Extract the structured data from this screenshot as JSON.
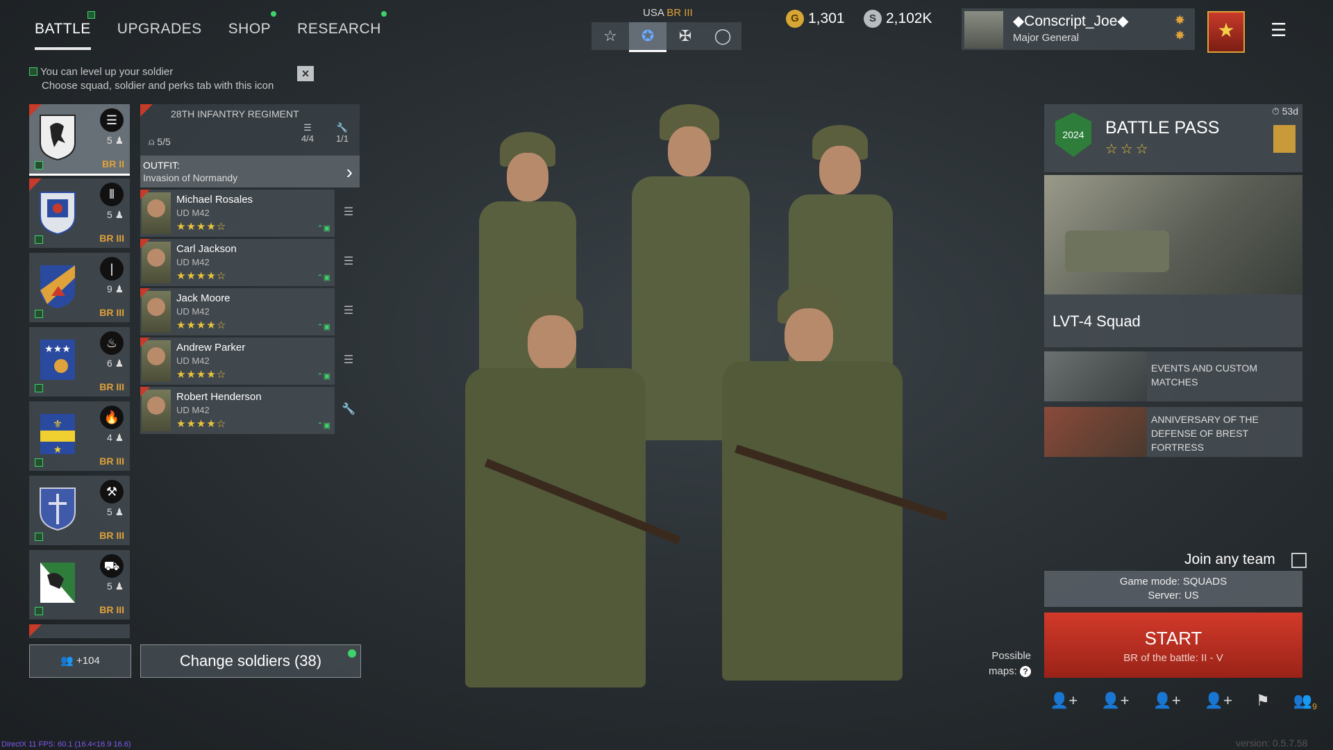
{
  "nav": {
    "tabs": [
      "BATTLE",
      "UPGRADES",
      "SHOP",
      "RESEARCH"
    ],
    "active": "BATTLE"
  },
  "hint": {
    "line1": "You can level up your soldier",
    "line2": "Choose squad, soldier and perks tab with this icon"
  },
  "squads": [
    {
      "count": "5",
      "br": "BR II"
    },
    {
      "count": "5",
      "br": "BR III"
    },
    {
      "count": "9",
      "br": "BR III"
    },
    {
      "count": "6",
      "br": "BR III"
    },
    {
      "count": "4",
      "br": "BR III"
    },
    {
      "count": "5",
      "br": "BR III"
    },
    {
      "count": "5",
      "br": "BR III"
    }
  ],
  "regiment": {
    "title": "28TH INFANTRY REGIMENT",
    "slots": "5/5",
    "perks": "4/4",
    "tools": "1/1",
    "outfit_label": "OUTFIT:",
    "outfit_value": "Invasion of Normandy"
  },
  "soldiers": [
    {
      "name": "Michael Rosales",
      "weapon": "UD M42",
      "stars": "★★★★☆"
    },
    {
      "name": "Carl Jackson",
      "weapon": "UD M42",
      "stars": "★★★★☆"
    },
    {
      "name": "Jack Moore",
      "weapon": "UD M42",
      "stars": "★★★★☆"
    },
    {
      "name": "Andrew Parker",
      "weapon": "UD M42",
      "stars": "★★★★☆"
    },
    {
      "name": "Robert Henderson",
      "weapon": "UD M42",
      "stars": "★★★★☆"
    }
  ],
  "buttons": {
    "group_count": "+104",
    "change_soldiers": "Change soldiers (38)"
  },
  "nation": {
    "label": "USA",
    "br": "BR III"
  },
  "currency": {
    "gold": "1,301",
    "silver": "2,102K"
  },
  "profile": {
    "name": "◆Conscript_Joe◆",
    "rank": "Major General"
  },
  "battle_pass": {
    "title": "BATTLE PASS",
    "stars": "☆☆☆",
    "days": "53d",
    "year": "2024"
  },
  "featured": {
    "label": "LVT-4 Squad"
  },
  "events": [
    {
      "text": "EVENTS AND CUSTOM MATCHES"
    },
    {
      "text": "ANNIVERSARY OF THE DEFENSE OF BREST FORTRESS"
    }
  ],
  "join": {
    "label": "Join any team"
  },
  "mode": {
    "line1": "Game mode: SQUADS",
    "line2": "Server: US"
  },
  "start": {
    "label": "START",
    "sub": "BR of the battle: II - V"
  },
  "maps": {
    "line1": "Possible",
    "line2": "maps:"
  },
  "bottom_icons": {
    "party_count": "9"
  },
  "debug": "DirectX 11 FPS: 60.1 (16.4<16.9 16.6)",
  "version": "version: 0.5.7.58",
  "colors": {
    "accent_green": "#3fd26a",
    "start_red": "#d23a2a",
    "br_orange": "#e0a23a",
    "star_yellow": "#e9c43a"
  }
}
